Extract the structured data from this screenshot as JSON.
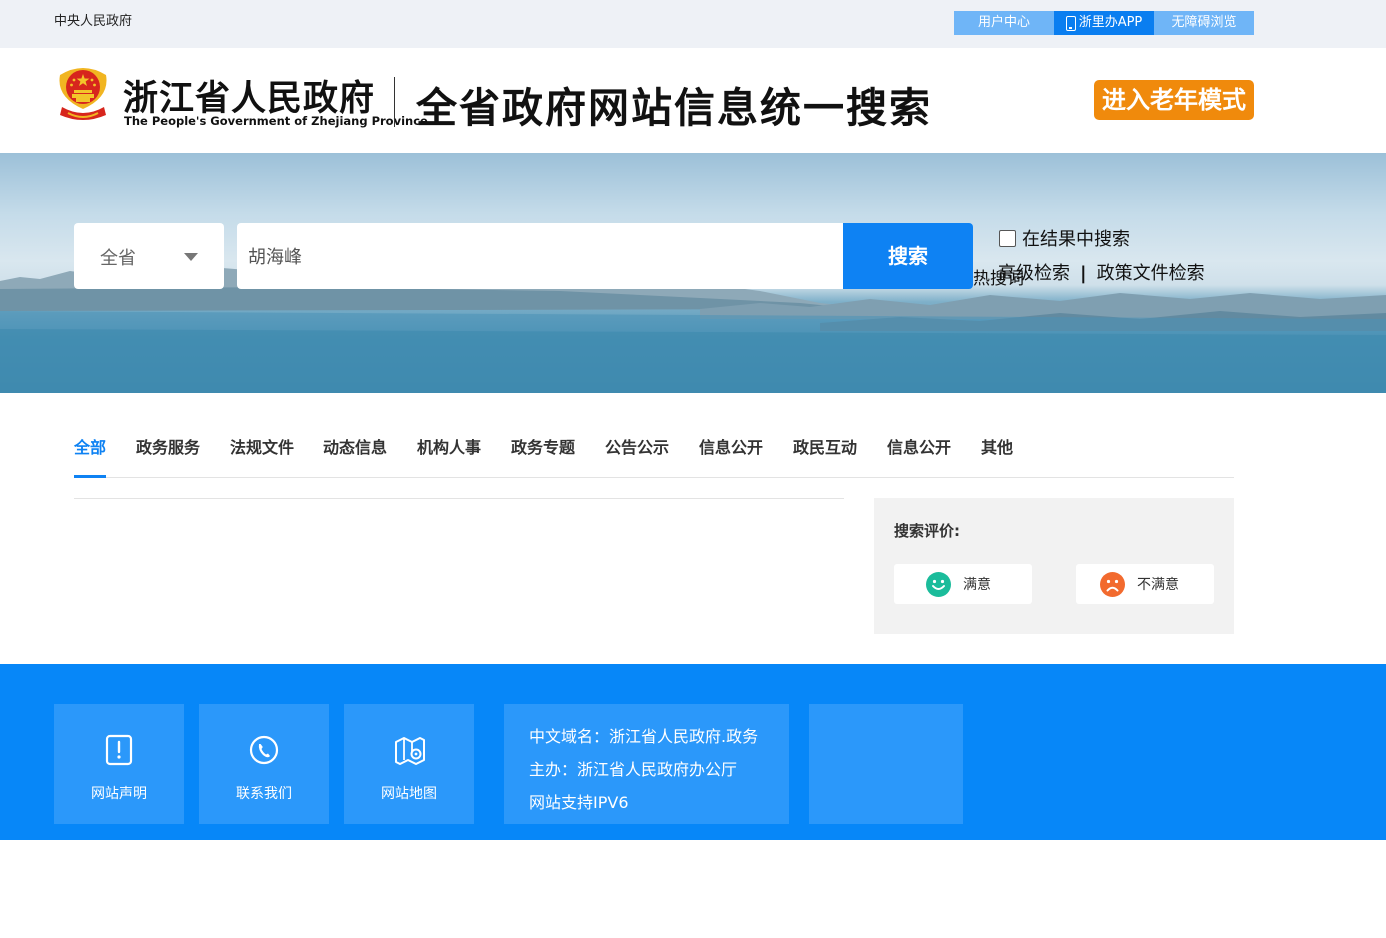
{
  "topbar": {
    "central_gov": "中央人民政府",
    "user_center": "用户中心",
    "app": "浙里办APP",
    "accessibility": "无障碍浏览"
  },
  "header": {
    "site_name": "浙江省人民政府",
    "site_name_en": "The People's Government of Zhejiang Province",
    "search_title": "全省政府网站信息统一搜索",
    "elder_mode": "进入老年模式"
  },
  "search": {
    "scope": "全省",
    "query": "胡海峰",
    "button": "搜索",
    "in_result": "在结果中搜索",
    "advanced": "高级检索",
    "policy": "政策文件检索",
    "hot_words": "热搜词"
  },
  "tabs": [
    "全部",
    "政务服务",
    "法规文件",
    "动态信息",
    "机构人事",
    "政务专题",
    "公告公示",
    "信息公开",
    "政民互动",
    "信息公开",
    "其他"
  ],
  "evaluation": {
    "title": "搜索评价:",
    "good": "满意",
    "bad": "不满意"
  },
  "footer": {
    "statement": "网站声明",
    "contact": "联系我们",
    "sitemap": "网站地图",
    "domain": "中文域名：浙江省人民政府.政务",
    "sponsor": "主办：浙江省人民政府办公厅",
    "ipv6": "网站支持IPV6"
  },
  "colors": {
    "primary": "#0e82f3",
    "footer": "#0787f8",
    "elder": "#f08a0c",
    "good": "#1bbc9b",
    "bad": "#f26a2e"
  }
}
